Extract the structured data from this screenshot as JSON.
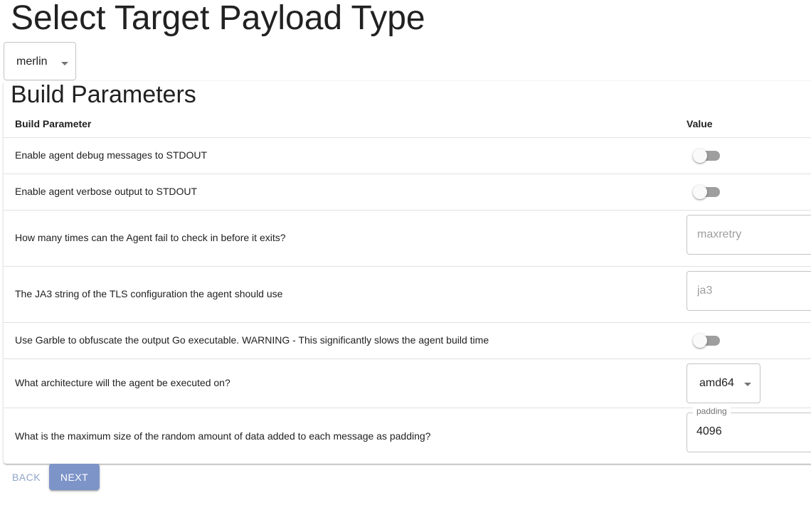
{
  "page": {
    "title": "Select Target Payload Type"
  },
  "payload_select": {
    "value": "merlin"
  },
  "build_params": {
    "section_title": "Build Parameters",
    "header_param": "Build Parameter",
    "header_value": "Value",
    "rows": [
      {
        "label": "Enable agent debug messages to STDOUT",
        "control": "switch",
        "checked": false
      },
      {
        "label": "Enable agent verbose output to STDOUT",
        "control": "switch",
        "checked": false
      },
      {
        "label": "How many times can the Agent fail to check in before it exits?",
        "control": "text",
        "placeholder": "maxretry",
        "value": ""
      },
      {
        "label": "The JA3 string of the TLS configuration the agent should use",
        "control": "text",
        "placeholder": "ja3",
        "value": ""
      },
      {
        "label": "Use Garble to obfuscate the output Go executable. WARNING - This significantly slows the agent build time",
        "control": "switch",
        "checked": false
      },
      {
        "label": "What architecture will the agent be executed on?",
        "control": "select",
        "value": "amd64"
      },
      {
        "label": "What is the maximum size of the random amount of data added to each message as padding?",
        "control": "text-labeled",
        "field_label": "padding",
        "value": "4096"
      }
    ]
  },
  "actions": {
    "back_label": "BACK",
    "next_label": "NEXT"
  },
  "colors": {
    "primary_button": "#7d94c8",
    "back_text": "#90a4c8",
    "switch_track_off": "#9e9e9e"
  }
}
